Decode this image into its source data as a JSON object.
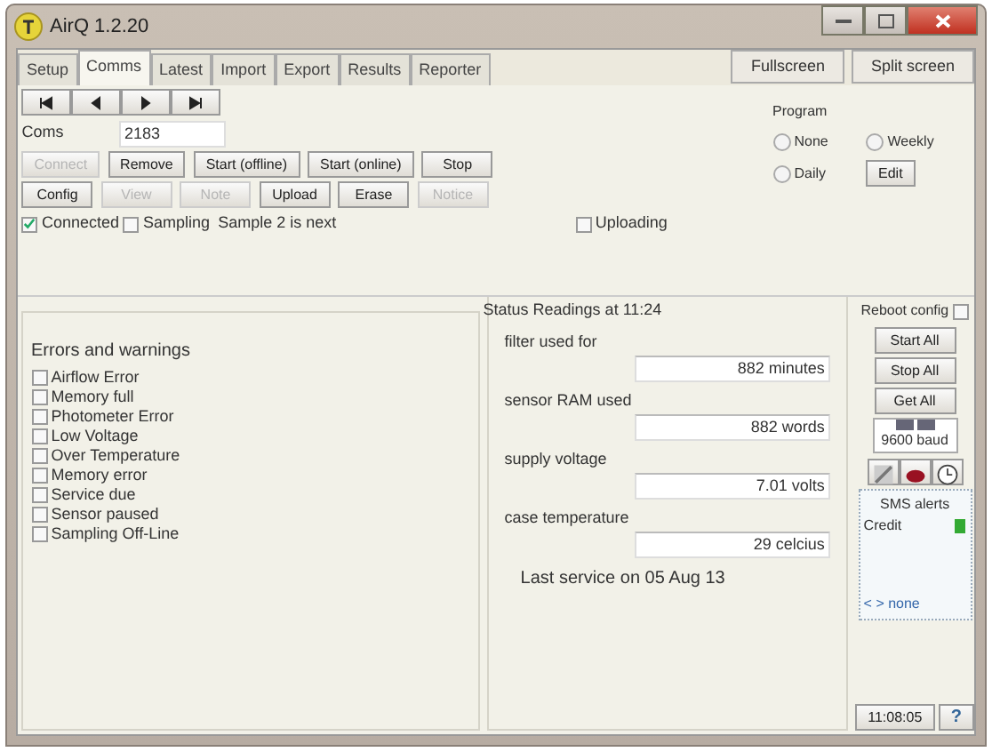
{
  "window": {
    "title": "AirQ 1.2.20"
  },
  "tabs": [
    {
      "label": "Setup",
      "selected": false
    },
    {
      "label": "Comms",
      "selected": true
    },
    {
      "label": "Latest",
      "selected": false
    },
    {
      "label": "Import",
      "selected": false
    },
    {
      "label": "Export",
      "selected": false
    },
    {
      "label": "Results",
      "selected": false
    },
    {
      "label": "Reporter",
      "selected": false
    }
  ],
  "view_buttons": [
    "Fullscreen",
    "Split screen"
  ],
  "port": {
    "label": "Coms",
    "value": "2183"
  },
  "action_rows": [
    [
      {
        "label": "Connect",
        "disabled": true
      },
      {
        "label": "Remove",
        "disabled": false
      },
      {
        "label": "Start (offline)",
        "disabled": false
      },
      {
        "label": "Start (online)",
        "disabled": false
      },
      {
        "label": "Stop",
        "disabled": false
      }
    ],
    [
      {
        "label": "Config",
        "disabled": false
      },
      {
        "label": "View",
        "disabled": true
      },
      {
        "label": "Note",
        "disabled": true
      },
      {
        "label": "Upload",
        "disabled": false
      },
      {
        "label": "Erase",
        "disabled": false
      },
      {
        "label": "Notice",
        "disabled": true
      }
    ]
  ],
  "status_checks": [
    {
      "label": "Connected",
      "checked": true
    },
    {
      "label": "Sampling",
      "checked": false
    }
  ],
  "sample_note": "Sample 2 is next",
  "uploading": {
    "label": "Uploading",
    "checked": false
  },
  "program": {
    "title": "Program",
    "options": [
      {
        "label": "None",
        "selected": false
      },
      {
        "label": "Weekly",
        "selected": false
      },
      {
        "label": "Daily",
        "selected": false
      }
    ],
    "edit_button": "Edit"
  },
  "errors": {
    "title": "Errors and warnings",
    "items": [
      {
        "label": "Airflow Error",
        "checked": false
      },
      {
        "label": "Memory full",
        "checked": false
      },
      {
        "label": "Photometer Error",
        "checked": false
      },
      {
        "label": "Low Voltage",
        "checked": false
      },
      {
        "label": "Over Temperature",
        "checked": false
      },
      {
        "label": "Memory error",
        "checked": false
      },
      {
        "label": "Service due",
        "checked": false
      },
      {
        "label": "Sensor paused",
        "checked": false
      },
      {
        "label": "Sampling Off-Line",
        "checked": false
      }
    ]
  },
  "status": {
    "title": "Status Readings at 11:24",
    "readings": [
      {
        "label": "filter used for",
        "value": "882 minutes"
      },
      {
        "label": "sensor RAM used",
        "value": "882 words"
      },
      {
        "label": "supply voltage",
        "value": "7.01 volts"
      },
      {
        "label": "case temperature",
        "value": "29 celcius"
      }
    ],
    "last_service": "Last service on  05 Aug 13"
  },
  "side": {
    "reboot": {
      "label": "Reboot config",
      "checked": false
    },
    "buttons": [
      "Start All",
      "Stop All",
      "Get All"
    ],
    "baud": "9600 baud",
    "sms": {
      "title": "SMS alerts",
      "credit": "Credit",
      "nav": "< > none"
    },
    "time": "11:08:05",
    "help": "?"
  }
}
